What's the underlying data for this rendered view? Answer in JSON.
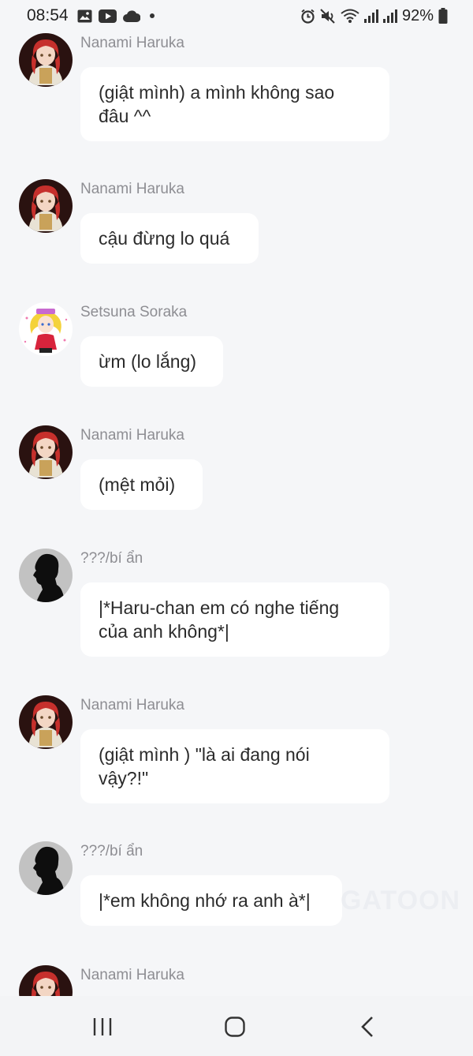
{
  "status_bar": {
    "time": "08:54",
    "left_icons": [
      "gallery-icon",
      "youtube-icon",
      "cloud-icon",
      "dot-icon"
    ],
    "right_icons": [
      "alarm-icon",
      "mute-icon",
      "wifi-icon",
      "signal-icon",
      "signal-icon",
      "battery-icon"
    ],
    "battery": "92%"
  },
  "messages": [
    {
      "sender": "Nanami Haruka",
      "avatar": "nanami",
      "lines": [
        "(giật mình) a mình không sao",
        "đâu ^^"
      ]
    },
    {
      "sender": "Nanami Haruka",
      "avatar": "nanami",
      "lines": [
        "cậu đừng lo quá"
      ]
    },
    {
      "sender": "Setsuna Soraka",
      "avatar": "setsuna",
      "lines": [
        "ừm (lo lắng)"
      ]
    },
    {
      "sender": "Nanami Haruka",
      "avatar": "nanami",
      "lines": [
        "(mệt mỏi)"
      ]
    },
    {
      "sender": "???/bí ẩn",
      "avatar": "silhouette",
      "lines": [
        "|*Haru-chan em có nghe tiếng",
        "của anh không*|"
      ]
    },
    {
      "sender": "Nanami Haruka",
      "avatar": "nanami",
      "lines": [
        "(giật mình ) \"là ai đang nói",
        "vậy?!\""
      ]
    },
    {
      "sender": "???/bí ẩn",
      "avatar": "silhouette",
      "lines": [
        "|*em không nhớ ra anh à*|"
      ]
    },
    {
      "sender": "Nanami Haruka",
      "avatar": "nanami",
      "lines": []
    }
  ],
  "watermark": "GATOON",
  "nav_bar": {
    "recents_icon": "recents-icon",
    "home_icon": "home-icon",
    "back_icon": "back-icon"
  },
  "colors": {
    "background": "#f5f6f8",
    "bubble": "#ffffff",
    "sender_text": "#8e8e93",
    "message_text": "#2b2b2b"
  }
}
